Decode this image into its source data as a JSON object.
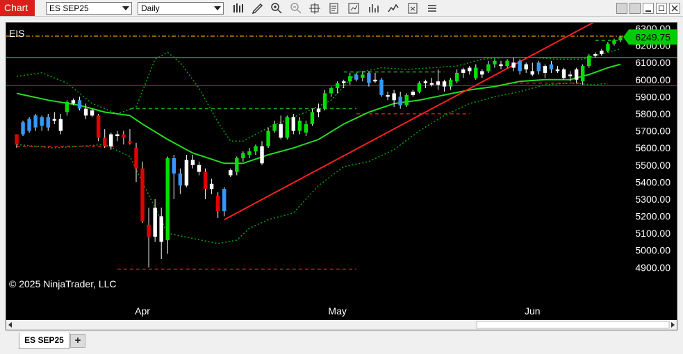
{
  "toolbar": {
    "chart_tab_label": "Chart",
    "instrument": "ES SEP25",
    "interval": "Daily",
    "icons": [
      "bar-type-icon",
      "draw-pencil-icon",
      "zoom-in-icon",
      "zoom-out-icon",
      "crosshair-icon",
      "data-box-icon",
      "strategies-icon",
      "indicators-icon",
      "properties-icon",
      "options-icon"
    ],
    "window_buttons": [
      "layout-icon",
      "minimize-icon",
      "maximize-icon",
      "close-icon"
    ]
  },
  "chart_label": "EIS",
  "copyright": "© 2025 NinjaTrader, LLC",
  "tabs": {
    "active": "ES SEP25",
    "add_label": "+"
  },
  "colors": {
    "up": "#00e000",
    "down": "#e00000",
    "blue": "#3399ff",
    "ma": "#22dd22",
    "bands": "#00aa00",
    "trendline": "#ff2020",
    "price_marker": "#00cc00"
  },
  "chart_data": {
    "type": "candlestick",
    "y_axis": {
      "min": 4820,
      "max": 6300,
      "ticks": [
        "6300.00",
        "6200.00",
        "6100.00",
        "6000.00",
        "5900.00",
        "5800.00",
        "5700.00",
        "5600.00",
        "5500.00",
        "5400.00",
        "5300.00",
        "5200.00",
        "5100.00",
        "5000.00",
        "4900.00"
      ]
    },
    "x_labels": [
      {
        "label": "Apr",
        "index": 20
      },
      {
        "label": "May",
        "index": 51
      },
      {
        "label": "Jun",
        "index": 82
      }
    ],
    "last_price": "6249.75",
    "candles": [
      {
        "o": 5620,
        "h": 5660,
        "l": 5600,
        "c": 5680,
        "col": "down"
      },
      {
        "o": 5680,
        "h": 5760,
        "l": 5670,
        "c": 5750,
        "col": "blue"
      },
      {
        "o": 5700,
        "h": 5780,
        "l": 5690,
        "c": 5770,
        "col": "blue"
      },
      {
        "o": 5720,
        "h": 5800,
        "l": 5700,
        "c": 5790,
        "col": "blue"
      },
      {
        "o": 5730,
        "h": 5790,
        "l": 5700,
        "c": 5780,
        "col": "blue"
      },
      {
        "o": 5720,
        "h": 5800,
        "l": 5700,
        "c": 5780,
        "col": "blue"
      },
      {
        "o": 5770,
        "h": 5810,
        "l": 5740,
        "c": 5760,
        "col": "white"
      },
      {
        "o": 5770,
        "h": 5800,
        "l": 5680,
        "c": 5700,
        "col": "white"
      },
      {
        "o": 5810,
        "h": 5880,
        "l": 5790,
        "c": 5870,
        "col": "up"
      },
      {
        "o": 5860,
        "h": 5890,
        "l": 5850,
        "c": 5880,
        "col": "white"
      },
      {
        "o": 5880,
        "h": 5900,
        "l": 5820,
        "c": 5830,
        "col": "blue"
      },
      {
        "o": 5830,
        "h": 5860,
        "l": 5770,
        "c": 5790,
        "col": "white"
      },
      {
        "o": 5790,
        "h": 5830,
        "l": 5780,
        "c": 5820,
        "col": "white"
      },
      {
        "o": 5790,
        "h": 5800,
        "l": 5640,
        "c": 5660,
        "col": "down"
      },
      {
        "o": 5660,
        "h": 5710,
        "l": 5600,
        "c": 5610,
        "col": "down"
      },
      {
        "o": 5610,
        "h": 5690,
        "l": 5590,
        "c": 5680,
        "col": "white"
      },
      {
        "o": 5680,
        "h": 5700,
        "l": 5640,
        "c": 5670,
        "col": "white"
      },
      {
        "o": 5680,
        "h": 5700,
        "l": 5620,
        "c": 5660,
        "col": "down"
      },
      {
        "o": 5630,
        "h": 5710,
        "l": 5620,
        "c": 5640,
        "col": "down"
      },
      {
        "o": 5600,
        "h": 5630,
        "l": 5400,
        "c": 5480,
        "col": "down"
      },
      {
        "o": 5480,
        "h": 5520,
        "l": 5160,
        "c": 5170,
        "col": "down"
      },
      {
        "o": 5150,
        "h": 5250,
        "l": 4900,
        "c": 5080,
        "col": "down"
      },
      {
        "o": 5080,
        "h": 5300,
        "l": 5050,
        "c": 5250,
        "col": "white"
      },
      {
        "o": 5050,
        "h": 5250,
        "l": 4950,
        "c": 5200,
        "col": "white"
      },
      {
        "o": 5060,
        "h": 5550,
        "l": 4980,
        "c": 5540,
        "col": "up"
      },
      {
        "o": 5540,
        "h": 5560,
        "l": 5300,
        "c": 5450,
        "col": "blue"
      },
      {
        "o": 5450,
        "h": 5480,
        "l": 5330,
        "c": 5380,
        "col": "blue"
      },
      {
        "o": 5380,
        "h": 5560,
        "l": 5370,
        "c": 5530,
        "col": "white"
      },
      {
        "o": 5530,
        "h": 5560,
        "l": 5480,
        "c": 5500,
        "col": "white"
      },
      {
        "o": 5500,
        "h": 5520,
        "l": 5440,
        "c": 5460,
        "col": "white"
      },
      {
        "o": 5460,
        "h": 5480,
        "l": 5300,
        "c": 5360,
        "col": "down"
      },
      {
        "o": 5360,
        "h": 5420,
        "l": 5330,
        "c": 5390,
        "col": "white"
      },
      {
        "o": 5320,
        "h": 5340,
        "l": 5190,
        "c": 5230,
        "col": "down"
      },
      {
        "o": 5230,
        "h": 5370,
        "l": 5200,
        "c": 5360,
        "col": "blue"
      },
      {
        "o": 5440,
        "h": 5480,
        "l": 5430,
        "c": 5470,
        "col": "white"
      },
      {
        "o": 5460,
        "h": 5550,
        "l": 5440,
        "c": 5540,
        "col": "up"
      },
      {
        "o": 5540,
        "h": 5580,
        "l": 5520,
        "c": 5570,
        "col": "up"
      },
      {
        "o": 5560,
        "h": 5600,
        "l": 5540,
        "c": 5580,
        "col": "up"
      },
      {
        "o": 5580,
        "h": 5620,
        "l": 5560,
        "c": 5610,
        "col": "up"
      },
      {
        "o": 5610,
        "h": 5640,
        "l": 5500,
        "c": 5510,
        "col": "white"
      },
      {
        "o": 5610,
        "h": 5720,
        "l": 5600,
        "c": 5700,
        "col": "up"
      },
      {
        "o": 5700,
        "h": 5760,
        "l": 5690,
        "c": 5740,
        "col": "up"
      },
      {
        "o": 5740,
        "h": 5790,
        "l": 5650,
        "c": 5660,
        "col": "white"
      },
      {
        "o": 5660,
        "h": 5790,
        "l": 5650,
        "c": 5780,
        "col": "up"
      },
      {
        "o": 5780,
        "h": 5800,
        "l": 5680,
        "c": 5700,
        "col": "white"
      },
      {
        "o": 5700,
        "h": 5780,
        "l": 5680,
        "c": 5760,
        "col": "up"
      },
      {
        "o": 5690,
        "h": 5760,
        "l": 5670,
        "c": 5740,
        "col": "up"
      },
      {
        "o": 5740,
        "h": 5830,
        "l": 5730,
        "c": 5810,
        "col": "up"
      },
      {
        "o": 5810,
        "h": 5860,
        "l": 5780,
        "c": 5830,
        "col": "white"
      },
      {
        "o": 5830,
        "h": 5940,
        "l": 5820,
        "c": 5920,
        "col": "up"
      },
      {
        "o": 5920,
        "h": 5960,
        "l": 5900,
        "c": 5950,
        "col": "up"
      },
      {
        "o": 5950,
        "h": 5990,
        "l": 5920,
        "c": 5980,
        "col": "up"
      },
      {
        "o": 5980,
        "h": 6000,
        "l": 5950,
        "c": 5990,
        "col": "white"
      },
      {
        "o": 5990,
        "h": 6040,
        "l": 5970,
        "c": 6020,
        "col": "up"
      },
      {
        "o": 6030,
        "h": 6040,
        "l": 5990,
        "c": 6000,
        "col": "blue"
      },
      {
        "o": 6010,
        "h": 6050,
        "l": 5990,
        "c": 6030,
        "col": "up"
      },
      {
        "o": 6040,
        "h": 6050,
        "l": 5960,
        "c": 5980,
        "col": "blue"
      },
      {
        "o": 6000,
        "h": 6040,
        "l": 5980,
        "c": 5990,
        "col": "white"
      },
      {
        "o": 6000,
        "h": 6010,
        "l": 5900,
        "c": 5910,
        "col": "blue"
      },
      {
        "o": 5910,
        "h": 5930,
        "l": 5880,
        "c": 5900,
        "col": "white"
      },
      {
        "o": 5880,
        "h": 5940,
        "l": 5840,
        "c": 5920,
        "col": "white"
      },
      {
        "o": 5900,
        "h": 5930,
        "l": 5830,
        "c": 5850,
        "col": "blue"
      },
      {
        "o": 5850,
        "h": 5920,
        "l": 5840,
        "c": 5910,
        "col": "up"
      },
      {
        "o": 5910,
        "h": 5940,
        "l": 5900,
        "c": 5930,
        "col": "white"
      },
      {
        "o": 5930,
        "h": 5990,
        "l": 5920,
        "c": 5980,
        "col": "up"
      },
      {
        "o": 5980,
        "h": 6000,
        "l": 5950,
        "c": 5990,
        "col": "white"
      },
      {
        "o": 5980,
        "h": 6010,
        "l": 5960,
        "c": 5970,
        "col": "white"
      },
      {
        "o": 5970,
        "h": 6060,
        "l": 5940,
        "c": 5990,
        "col": "white"
      },
      {
        "o": 5990,
        "h": 6000,
        "l": 5930,
        "c": 5960,
        "col": "white"
      },
      {
        "o": 5960,
        "h": 6010,
        "l": 5940,
        "c": 6000,
        "col": "up"
      },
      {
        "o": 5990,
        "h": 6060,
        "l": 5980,
        "c": 6040,
        "col": "up"
      },
      {
        "o": 6040,
        "h": 6070,
        "l": 6010,
        "c": 6060,
        "col": "white"
      },
      {
        "o": 6050,
        "h": 6080,
        "l": 6030,
        "c": 6070,
        "col": "white"
      },
      {
        "o": 6070,
        "h": 6090,
        "l": 6000,
        "c": 6010,
        "col": "up"
      },
      {
        "o": 6030,
        "h": 6060,
        "l": 6010,
        "c": 6050,
        "col": "white"
      },
      {
        "o": 6050,
        "h": 6110,
        "l": 6040,
        "c": 6090,
        "col": "up"
      },
      {
        "o": 6090,
        "h": 6120,
        "l": 6070,
        "c": 6110,
        "col": "up"
      },
      {
        "o": 6090,
        "h": 6110,
        "l": 6060,
        "c": 6080,
        "col": "white"
      },
      {
        "o": 6080,
        "h": 6120,
        "l": 6070,
        "c": 6110,
        "col": "up"
      },
      {
        "o": 6100,
        "h": 6130,
        "l": 6050,
        "c": 6070,
        "col": "white"
      },
      {
        "o": 6110,
        "h": 6120,
        "l": 6030,
        "c": 6050,
        "col": "blue"
      },
      {
        "o": 6060,
        "h": 6100,
        "l": 6040,
        "c": 6090,
        "col": "white"
      },
      {
        "o": 6050,
        "h": 6100,
        "l": 6020,
        "c": 6030,
        "col": "white"
      },
      {
        "o": 6100,
        "h": 6110,
        "l": 6030,
        "c": 6050,
        "col": "blue"
      },
      {
        "o": 6040,
        "h": 6090,
        "l": 6010,
        "c": 6080,
        "col": "white"
      },
      {
        "o": 6090,
        "h": 6110,
        "l": 6040,
        "c": 6060,
        "col": "blue"
      },
      {
        "o": 6060,
        "h": 6080,
        "l": 6040,
        "c": 6050,
        "col": "white"
      },
      {
        "o": 6060,
        "h": 6070,
        "l": 6000,
        "c": 6010,
        "col": "white"
      },
      {
        "o": 6020,
        "h": 6050,
        "l": 5990,
        "c": 6030,
        "col": "white"
      },
      {
        "o": 6000,
        "h": 6070,
        "l": 5980,
        "c": 6060,
        "col": "white"
      },
      {
        "o": 5990,
        "h": 6090,
        "l": 5970,
        "c": 6080,
        "col": "up"
      },
      {
        "o": 6080,
        "h": 6150,
        "l": 6070,
        "c": 6140,
        "col": "up"
      },
      {
        "o": 6140,
        "h": 6160,
        "l": 6130,
        "c": 6150,
        "col": "white"
      },
      {
        "o": 6150,
        "h": 6180,
        "l": 6140,
        "c": 6170,
        "col": "white"
      },
      {
        "o": 6170,
        "h": 6220,
        "l": 6160,
        "c": 6210,
        "col": "up"
      },
      {
        "o": 6210,
        "h": 6240,
        "l": 6200,
        "c": 6230,
        "col": "up"
      },
      {
        "o": 6230,
        "h": 6255,
        "l": 6220,
        "c": 6250,
        "col": "up"
      }
    ],
    "ma_line": [
      [
        0,
        5920
      ],
      [
        5,
        5880
      ],
      [
        10,
        5850
      ],
      [
        14,
        5810
      ],
      [
        18,
        5790
      ],
      [
        20,
        5740
      ],
      [
        24,
        5650
      ],
      [
        28,
        5570
      ],
      [
        33,
        5510
      ],
      [
        36,
        5510
      ],
      [
        40,
        5560
      ],
      [
        44,
        5600
      ],
      [
        48,
        5650
      ],
      [
        52,
        5740
      ],
      [
        56,
        5810
      ],
      [
        60,
        5860
      ],
      [
        64,
        5880
      ],
      [
        68,
        5910
      ],
      [
        72,
        5940
      ],
      [
        76,
        5960
      ],
      [
        80,
        5990
      ],
      [
        84,
        6000
      ],
      [
        88,
        6000
      ],
      [
        91,
        6030
      ],
      [
        94,
        6070
      ],
      [
        96,
        6090
      ]
    ],
    "upper_band": [
      [
        0,
        6020
      ],
      [
        4,
        6040
      ],
      [
        8,
        5980
      ],
      [
        12,
        5860
      ],
      [
        16,
        5800
      ],
      [
        19,
        5840
      ],
      [
        22,
        6120
      ],
      [
        24,
        6160
      ],
      [
        26,
        6100
      ],
      [
        29,
        5950
      ],
      [
        32,
        5750
      ],
      [
        34,
        5640
      ],
      [
        36,
        5640
      ],
      [
        40,
        5720
      ],
      [
        46,
        5810
      ],
      [
        50,
        5880
      ],
      [
        52,
        5960
      ],
      [
        54,
        6040
      ],
      [
        58,
        6070
      ],
      [
        62,
        6060
      ],
      [
        66,
        6070
      ],
      [
        70,
        6080
      ],
      [
        74,
        6120
      ],
      [
        78,
        6130
      ],
      [
        82,
        6130
      ],
      [
        86,
        6120
      ],
      [
        90,
        6120
      ],
      [
        94,
        6160
      ],
      [
        96,
        6180
      ]
    ],
    "lower_band": [
      [
        0,
        5620
      ],
      [
        6,
        5600
      ],
      [
        10,
        5610
      ],
      [
        14,
        5620
      ],
      [
        18,
        5550
      ],
      [
        22,
        5250
      ],
      [
        24,
        5100
      ],
      [
        28,
        5070
      ],
      [
        32,
        5040
      ],
      [
        35,
        5060
      ],
      [
        37,
        5130
      ],
      [
        40,
        5180
      ],
      [
        44,
        5220
      ],
      [
        48,
        5380
      ],
      [
        52,
        5490
      ],
      [
        56,
        5520
      ],
      [
        60,
        5590
      ],
      [
        64,
        5700
      ],
      [
        68,
        5790
      ],
      [
        72,
        5860
      ],
      [
        76,
        5900
      ],
      [
        80,
        5930
      ],
      [
        84,
        5970
      ],
      [
        88,
        5980
      ],
      [
        92,
        5970
      ],
      [
        94,
        5980
      ]
    ],
    "horizontal_lines": [
      {
        "price": 6130,
        "color": "#22cc22",
        "style": "solid"
      },
      {
        "price": 5965,
        "color": "#d00000",
        "style": "solid"
      },
      {
        "price": 6255,
        "color": "#ffa000",
        "style": "dashdot"
      }
    ],
    "dashed_levels": [
      {
        "price": 6045,
        "from": 52,
        "to": 68,
        "color": "#22aa22"
      },
      {
        "price": 5830,
        "from": 18,
        "to": 54,
        "color": "#22aa22"
      },
      {
        "price": 5610,
        "from": 0,
        "to": 16,
        "color": "#dd2222"
      },
      {
        "price": 5800,
        "from": 54,
        "to": 72,
        "color": "#dd2222"
      },
      {
        "price": 4890,
        "from": 16,
        "to": 54,
        "color": "#dd2222"
      },
      {
        "price": 5980,
        "from": 78,
        "to": 90,
        "color": "#dd2222"
      },
      {
        "price": 6230,
        "from": 92,
        "to": 96,
        "color": "#22aa22"
      }
    ],
    "trendline": {
      "from": [
        33,
        5180
      ],
      "to": [
        96,
        6420
      ]
    }
  }
}
